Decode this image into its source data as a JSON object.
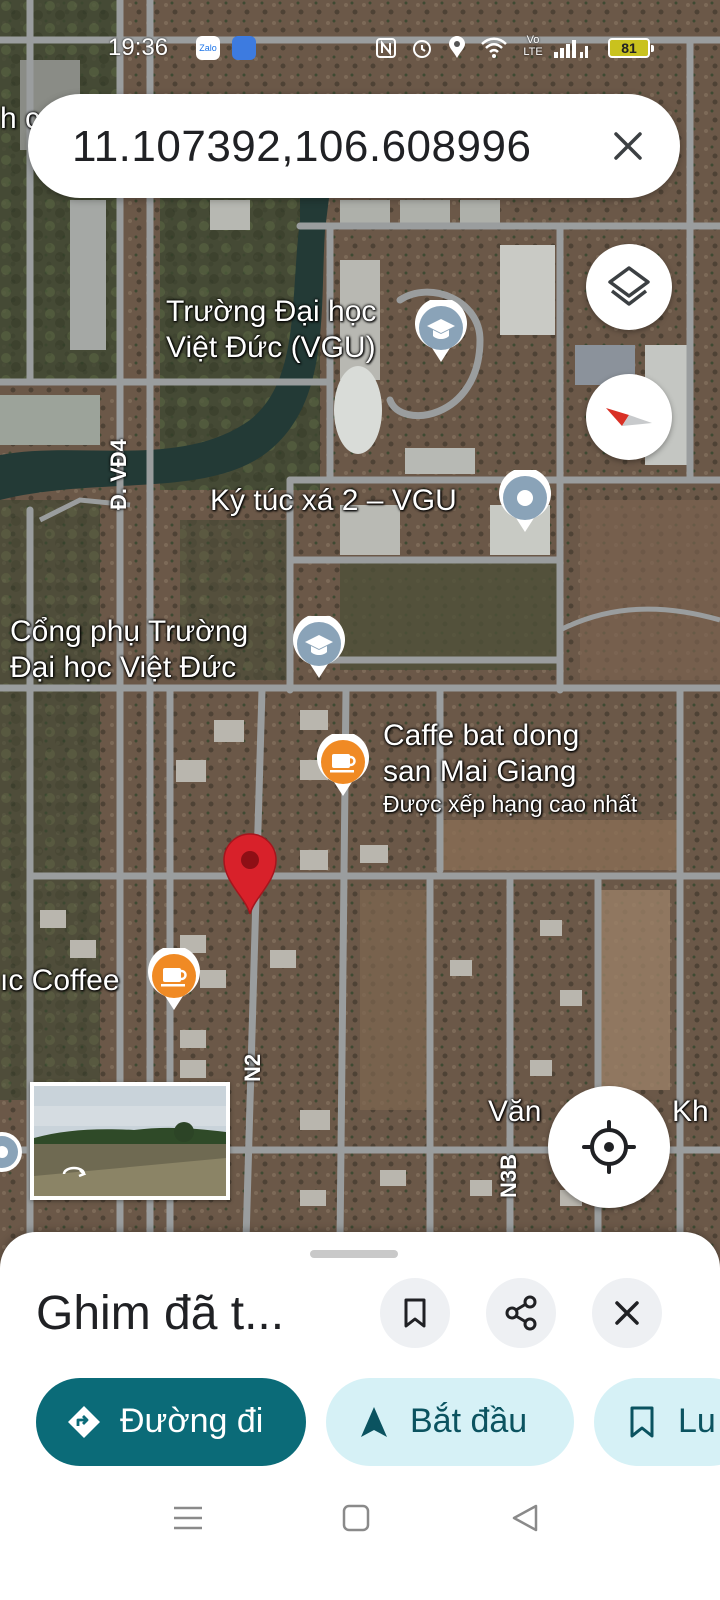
{
  "status_bar": {
    "time": "19:36",
    "app_icons": [
      "zalo-icon",
      "app-icon"
    ],
    "zalo_text": "Zalo",
    "volte_text": "Vo LTE",
    "battery_level": "81"
  },
  "search": {
    "query": "11.107392,106.608996"
  },
  "map": {
    "labels": {
      "truncated_top": "h c",
      "vgu_line1": "Trường Đại học",
      "vgu_line2": "Việt Đức (VGU)",
      "dorm": "Ký túc xá 2 – VGU",
      "gate_line1": "Cổng phụ Trường",
      "gate_line2": "Đại học Việt Đức",
      "caffe_line1": "Caffe bat dong",
      "caffe_line2": "san Mai Giang",
      "caffe_rating": "Được xếp hạng cao nhất",
      "coffee": "ıc Coffee",
      "bottom_right": "Văn",
      "bottom_right_2": "Kh"
    },
    "roads": {
      "vd4": "Đ. VĐ4",
      "n2": "N2",
      "n3b": "N3B"
    },
    "pin_color": "#d8212a",
    "poi_colors": {
      "school": "#8aa3b8",
      "cafe": "#f08a24"
    }
  },
  "sheet": {
    "title": "Ghim đã t...",
    "directions_label": "Đường đi",
    "start_label": "Bắt đầu",
    "save_label": "Lu"
  },
  "colors": {
    "primary": "#0b6b78",
    "chip_bg": "#d6f1f6",
    "chip_text": "#0b5360"
  }
}
